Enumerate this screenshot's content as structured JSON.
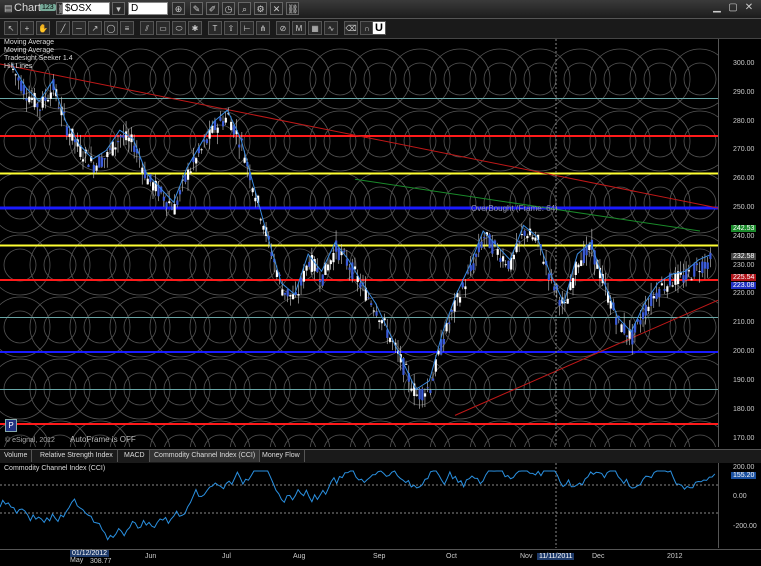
{
  "window": {
    "title": "Chart",
    "badge": "123",
    "symbol": "$OSX",
    "interval": "D"
  },
  "toolbar2": {
    "highlight": "U"
  },
  "legend": [
    "Moving Average",
    "Moving Average",
    "Tradesight Seeker 1.4",
    "Hill Lines"
  ],
  "overlay": {
    "overbought": "OverBought (Frame: 64)",
    "autoframe": "AutoFrame is OFF",
    "copyright": "© eSignal, 2012",
    "p_button": "P"
  },
  "price_axis": {
    "ticks": [
      "300.00",
      "290.00",
      "280.00",
      "270.00",
      "260.00",
      "250.00",
      "240.00",
      "230.00",
      "220.00",
      "210.00",
      "200.00",
      "190.00",
      "180.00",
      "170.00"
    ],
    "tags": [
      {
        "v": "242.53",
        "c": "#1a8a2a"
      },
      {
        "v": "232.58",
        "c": "#444"
      },
      {
        "v": "225.54",
        "c": "#b0141a"
      },
      {
        "v": "223.08",
        "c": "#2030c0"
      }
    ]
  },
  "tabs": [
    "Volume",
    "Relative Strength Index",
    "MACD",
    "Commodity Channel Index (CCI)",
    "Money Flow"
  ],
  "cci": {
    "title": "Commodity Channel Index (CCI)",
    "ticks": [
      "200.00",
      "0.00",
      "-200.00"
    ],
    "value": "155.20"
  },
  "xaxis": {
    "labels": [
      "Jun",
      "Jul",
      "Aug",
      "Sep",
      "Oct",
      "Nov",
      "Dec",
      "2012"
    ],
    "cursor_date": "11/11/2011",
    "left_date": "01/12/2012",
    "left_month": "May",
    "left_val": "308.77"
  },
  "colors": {
    "red": "#ff1a1a",
    "yellow": "#ffff33",
    "blue": "#1a1aff",
    "teal": "#6aa8a8",
    "green": "#22aa22"
  }
}
